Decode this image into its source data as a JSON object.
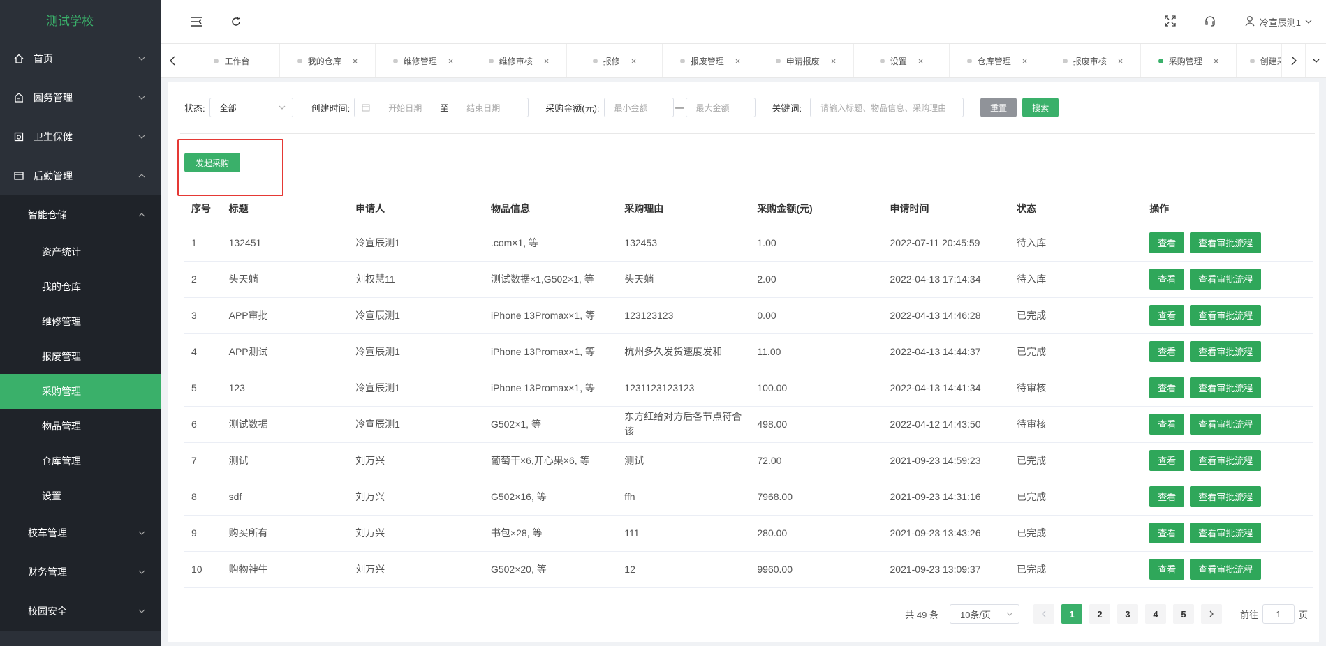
{
  "app": {
    "title": "测试学校"
  },
  "sidebar": {
    "items": [
      {
        "label": "首页"
      },
      {
        "label": "园务管理"
      },
      {
        "label": "卫生保健"
      },
      {
        "label": "后勤管理"
      }
    ],
    "group": {
      "label": "智能仓储"
    },
    "sub_items": [
      {
        "label": "资产统计"
      },
      {
        "label": "我的仓库"
      },
      {
        "label": "维修管理"
      },
      {
        "label": "报废管理"
      },
      {
        "label": "采购管理"
      },
      {
        "label": "物品管理"
      },
      {
        "label": "仓库管理"
      },
      {
        "label": "设置"
      }
    ],
    "bottom_items": [
      {
        "label": "校车管理"
      },
      {
        "label": "财务管理"
      },
      {
        "label": "校园安全"
      }
    ]
  },
  "header": {
    "user_name": "冷宣辰测1"
  },
  "tabs": [
    {
      "label": "工作台"
    },
    {
      "label": "我的仓库"
    },
    {
      "label": "维修管理"
    },
    {
      "label": "维修审核"
    },
    {
      "label": "报修"
    },
    {
      "label": "报废管理"
    },
    {
      "label": "申请报废"
    },
    {
      "label": "设置"
    },
    {
      "label": "仓库管理"
    },
    {
      "label": "报废审核"
    },
    {
      "label": "采购管理"
    },
    {
      "label": "创建采购单"
    }
  ],
  "filters": {
    "status_label": "状态:",
    "status_value": "全部",
    "created_label": "创建时间:",
    "start_placeholder": "开始日期",
    "range_sep": "至",
    "end_placeholder": "结束日期",
    "amount_label": "采购金额(元):",
    "min_placeholder": "最小金额",
    "amount_dash": "一",
    "max_placeholder": "最大金额",
    "keyword_label": "关键词:",
    "keyword_placeholder": "请输入标题、物品信息、采购理由",
    "reset": "重置",
    "search": "搜索"
  },
  "launch_button": "发起采购",
  "table": {
    "columns": [
      "序号",
      "标题",
      "申请人",
      "物品信息",
      "采购理由",
      "采购金额(元)",
      "申请时间",
      "状态",
      "操作"
    ],
    "view_label": "查看",
    "flow_label": "查看审批流程",
    "rows": [
      [
        "1",
        "132451",
        "冷宣辰测1",
        ".com×1, 等",
        "132453",
        "1.00",
        "2022-07-11 20:45:59",
        "待入库"
      ],
      [
        "2",
        "头天躺",
        "刘权慧11",
        "测试数据×1,G502×1, 等",
        "头天躺",
        "2.00",
        "2022-04-13 17:14:34",
        "待入库"
      ],
      [
        "3",
        "APP审批",
        "冷宣辰测1",
        "iPhone 13Promax×1, 等",
        "123123123",
        "0.00",
        "2022-04-13 14:46:28",
        "已完成"
      ],
      [
        "4",
        "APP测试",
        "冷宣辰测1",
        "iPhone 13Promax×1, 等",
        "杭州多久发货速度发和",
        "11.00",
        "2022-04-13 14:44:37",
        "已完成"
      ],
      [
        "5",
        "123",
        "冷宣辰测1",
        "iPhone 13Promax×1, 等",
        "1231123123123",
        "100.00",
        "2022-04-13 14:41:34",
        "待审核"
      ],
      [
        "6",
        "测试数据",
        "冷宣辰测1",
        "G502×1, 等",
        "东方红给对方后各节点符合该",
        "498.00",
        "2022-04-12 14:43:50",
        "待审核"
      ],
      [
        "7",
        "测试",
        "刘万兴",
        "葡萄干×6,开心果×6, 等",
        "测试",
        "72.00",
        "2021-09-23 14:59:23",
        "已完成"
      ],
      [
        "8",
        "sdf",
        "刘万兴",
        "G502×16, 等",
        "ffh",
        "7968.00",
        "2021-09-23 14:31:16",
        "已完成"
      ],
      [
        "9",
        "购买所有",
        "刘万兴",
        "书包×28, 等",
        "111",
        "280.00",
        "2021-09-23 13:43:26",
        "已完成"
      ],
      [
        "10",
        "购物神牛",
        "刘万兴",
        "G502×20, 等",
        "12",
        "9960.00",
        "2021-09-23 13:09:37",
        "已完成"
      ]
    ]
  },
  "pagination": {
    "total": "共 49 条",
    "page_size": "10条/页",
    "pages": [
      "1",
      "2",
      "3",
      "4",
      "5"
    ],
    "current": "1",
    "goto_prefix": "前往",
    "goto_value": "1",
    "goto_suffix": "页"
  },
  "colors": {
    "primary": "#3ab06a",
    "sidebar": "#2b3038",
    "danger": "#e53935"
  }
}
